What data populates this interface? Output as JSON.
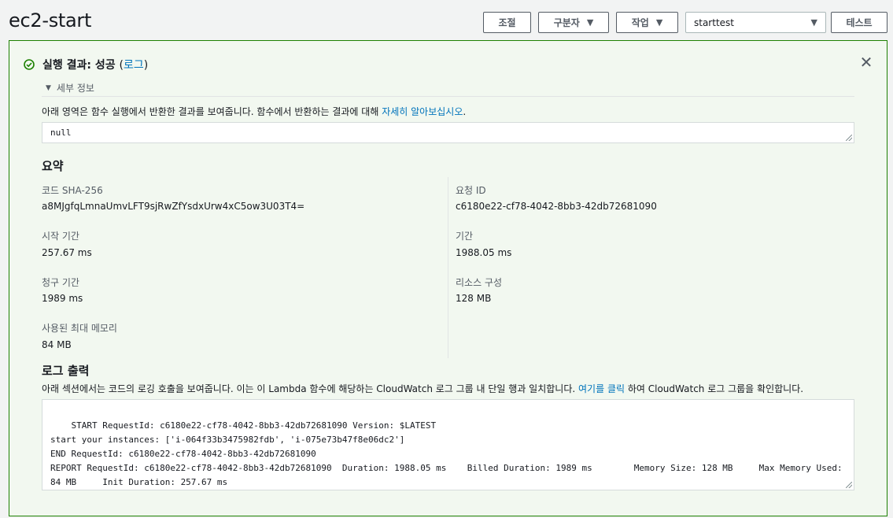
{
  "page": {
    "title": "ec2-start"
  },
  "toolbar": {
    "adjust_label": "조절",
    "qualifier_label": "구분자",
    "actions_label": "작업",
    "test_event_selected": "starttest",
    "test_label": "테스트"
  },
  "result": {
    "status_text": "실행 결과: 성공",
    "paren_open": "(",
    "log_link": "로그",
    "paren_close": ")",
    "details_label": "세부 정보",
    "description": "아래 영역은 함수 실행에서 반환한 결과를 보여줍니다. 함수에서 반환하는 결과에 대해 ",
    "learn_more_link": "자세히 알아보십시오",
    "description_end": ".",
    "return_value": "null"
  },
  "summary": {
    "heading": "요약",
    "code_sha_label": "코드 SHA-256",
    "code_sha_value": "a8MJgfqLmnaUmvLFT9sjRwZfYsdxUrw4xC5ow3U03T4=",
    "request_id_label": "요청 ID",
    "request_id_value": "c6180e22-cf78-4042-8bb3-42db72681090",
    "init_duration_label": "시작 기간",
    "init_duration_value": "257.67 ms",
    "duration_label": "기간",
    "duration_value": "1988.05 ms",
    "billed_label": "청구 기간",
    "billed_value": "1989 ms",
    "resources_label": "리소스 구성",
    "resources_value": "128 MB",
    "max_memory_label": "사용된 최대 메모리",
    "max_memory_value": "84 MB"
  },
  "log": {
    "heading": "로그 출력",
    "desc_start": "아래 섹션에서는 코드의 로깅 호출을 보여줍니다. 이는 이 Lambda 함수에 해당하는 CloudWatch 로그 그룹 내 단일 행과 일치합니다. ",
    "click_link": "여기를 클릭",
    "desc_end": "하여 CloudWatch 로그 그룹을 확인합니다.",
    "output": "START RequestId: c6180e22-cf78-4042-8bb3-42db72681090 Version: $LATEST\nstart your instances: ['i-064f33b3475982fdb', 'i-075e73b47f8e06dc2']\nEND RequestId: c6180e22-cf78-4042-8bb3-42db72681090\nREPORT RequestId: c6180e22-cf78-4042-8bb3-42db72681090  Duration: 1988.05 ms    Billed Duration: 1989 ms        Memory Size: 128 MB     Max Memory Used: 84 MB     Init Duration: 257.67 ms"
  },
  "colors": {
    "success_green": "#1d8102",
    "panel_bg": "#f2f8f0",
    "link_blue": "#0073bb"
  },
  "icons": {
    "status": "check-circle-icon",
    "close": "close-icon",
    "dropdown": "caret-down-icon",
    "expand": "triangle-down-icon"
  }
}
